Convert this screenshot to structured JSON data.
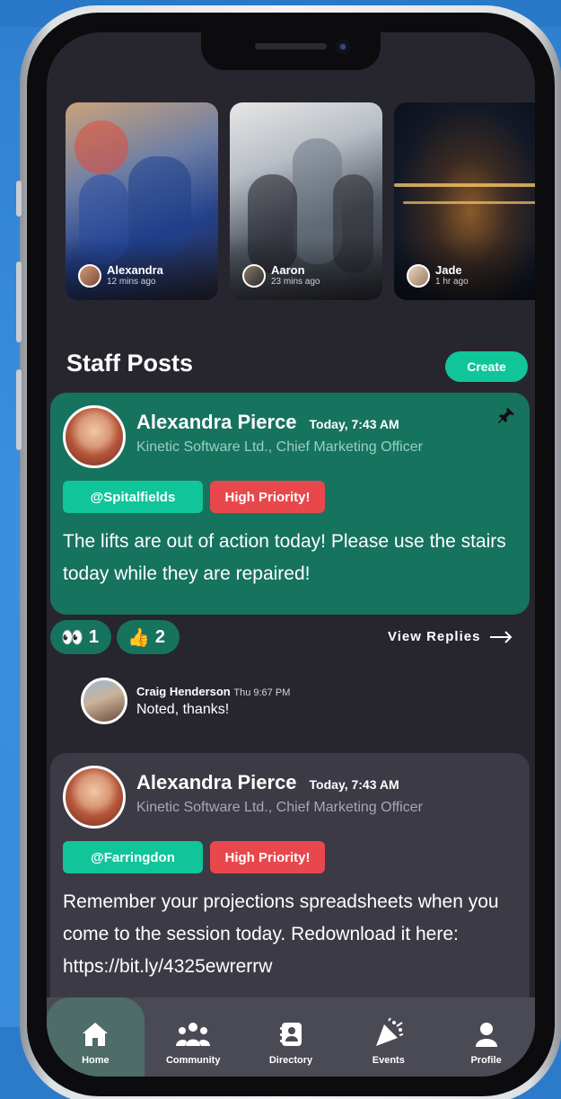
{
  "stories": [
    {
      "name": "Alexandra",
      "time": "12 mins ago"
    },
    {
      "name": "Aaron",
      "time": "23 mins ago"
    },
    {
      "name": "Jade",
      "time": "1 hr ago"
    }
  ],
  "section": {
    "title": "Staff Posts",
    "create_label": "Create"
  },
  "posts": [
    {
      "author": "Alexandra Pierce",
      "time": "Today, 7:43 AM",
      "role": "Kinetic Software Ltd., Chief Marketing Officer",
      "location_tag": "@Spitalfields",
      "priority_tag": "High Priority!",
      "text": "The lifts are out of action today! Please use the stairs today while they are repaired!"
    },
    {
      "author": "Alexandra Pierce",
      "time": "Today, 7:43 AM",
      "role": "Kinetic Software Ltd., Chief Marketing Officer",
      "location_tag": "@Farringdon",
      "priority_tag": "High Priority!",
      "text": "Remember your projections spreadsheets when you come to the session today. Redownload it here: https://bit.ly/4325ewrerrw"
    }
  ],
  "reactions": [
    {
      "icon": "eyes-icon",
      "emoji": "👀",
      "count": "1"
    },
    {
      "icon": "thumbs-up-icon",
      "emoji": "👍",
      "count": "2"
    }
  ],
  "view_replies_label": "View Replies",
  "reply": {
    "name": "Craig Henderson",
    "time": "Thu 9:67 PM",
    "text": "Noted, thanks!"
  },
  "tabs": [
    {
      "label": "Home",
      "icon": "home-icon"
    },
    {
      "label": "Community",
      "icon": "community-icon"
    },
    {
      "label": "Directory",
      "icon": "directory-icon"
    },
    {
      "label": "Events",
      "icon": "party-icon"
    },
    {
      "label": "Profile",
      "icon": "profile-icon"
    }
  ],
  "colors": {
    "accent": "#10c59a",
    "pinned_post": "#16735e",
    "priority": "#e8474c",
    "background": "#27262e"
  }
}
